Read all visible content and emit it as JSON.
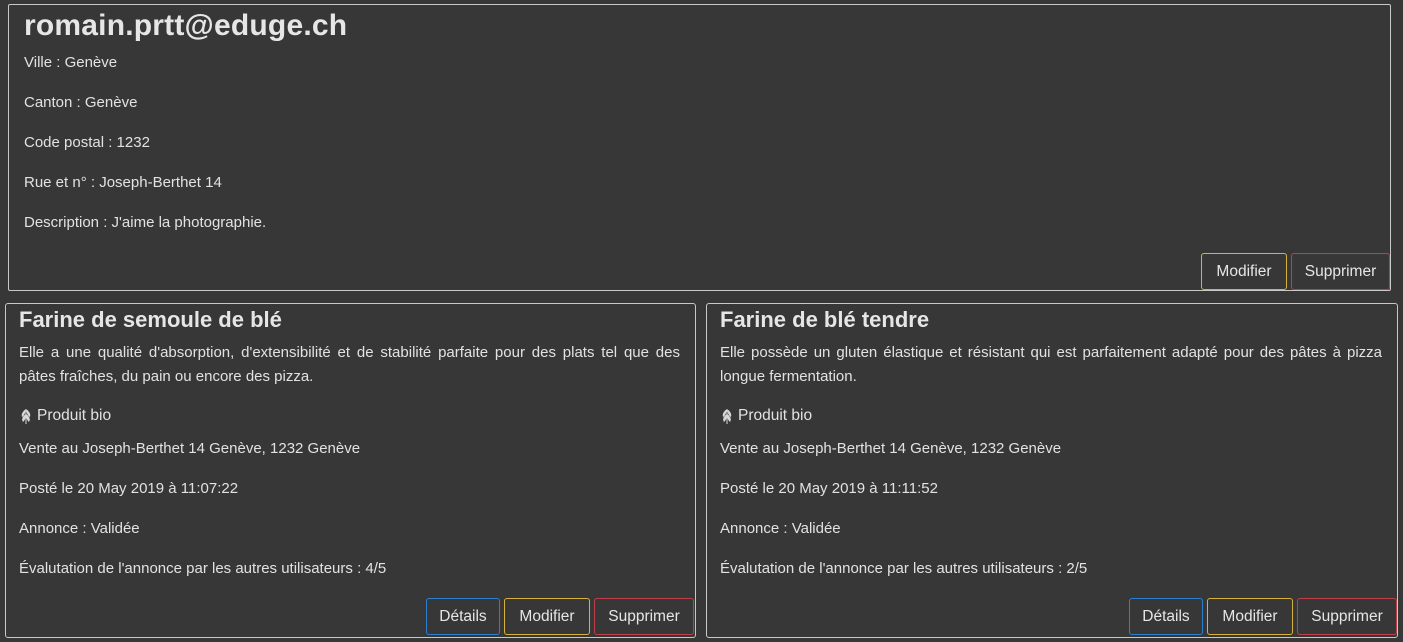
{
  "profile": {
    "email": "romain.prtt@eduge.ch",
    "ville": "Ville : Genève",
    "canton": "Canton : Genève",
    "code_postal": "Code postal : 1232",
    "rue": "Rue et n° : Joseph-Berthet 14",
    "description": "Description : J'aime la photographie.",
    "modify_label": "Modifier",
    "delete_label": "Supprimer"
  },
  "ads": [
    {
      "title": "Farine de semoule de blé",
      "description": "Elle a une qualité d'absorption, d'extensibilité et de stabilité parfaite pour des plats tel que des pâtes fraîches, du pain ou encore des pizza.",
      "bio": "Produit bio",
      "sale_location": "Vente au Joseph-Berthet 14 Genève, 1232 Genève",
      "posted": "Posté le 20 May 2019 à 11:07:22",
      "status": "Annonce : Validée",
      "rating": "Évalutation de l'annonce par les autres utilisateurs : 4/5",
      "details_label": "Détails",
      "modify_label": "Modifier",
      "delete_label": "Supprimer"
    },
    {
      "title": "Farine de blé tendre",
      "description": "Elle possède un gluten élastique et résistant qui est parfaitement adapté pour des pâtes à pizza longue fermentation.",
      "bio": "Produit bio",
      "sale_location": "Vente au Joseph-Berthet 14 Genève, 1232 Genève",
      "posted": "Posté le 20 May 2019 à 11:11:52",
      "status": "Annonce : Validée",
      "rating": "Évalutation de l'annonce par les autres utilisateurs : 2/5",
      "details_label": "Détails",
      "modify_label": "Modifier",
      "delete_label": "Supprimer"
    }
  ],
  "icons": {
    "bio": "leaf-icon"
  },
  "colors": {
    "background": "#373737",
    "border": "#c8c8c8",
    "warning": "#d9b23a",
    "danger": "#c0404a",
    "info": "#2e7fd1"
  }
}
